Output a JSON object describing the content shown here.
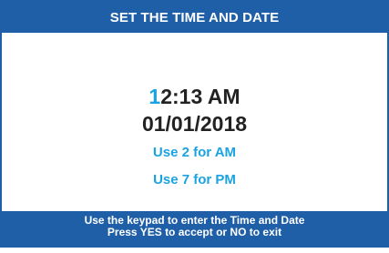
{
  "header": {
    "title": "SET THE TIME AND DATE"
  },
  "display": {
    "time_cursor_digit": "1",
    "time_rest": "2:13 AM",
    "date": "01/01/2018",
    "hint_am": "Use 2 for AM",
    "hint_pm": "Use 7 for PM"
  },
  "footer": {
    "line1": "Use the keypad to enter the Time and Date",
    "line2": "Press YES to accept or NO to exit"
  },
  "colors": {
    "bar": "#1f5fa8",
    "accent": "#1aa3e0",
    "text": "#222222"
  }
}
